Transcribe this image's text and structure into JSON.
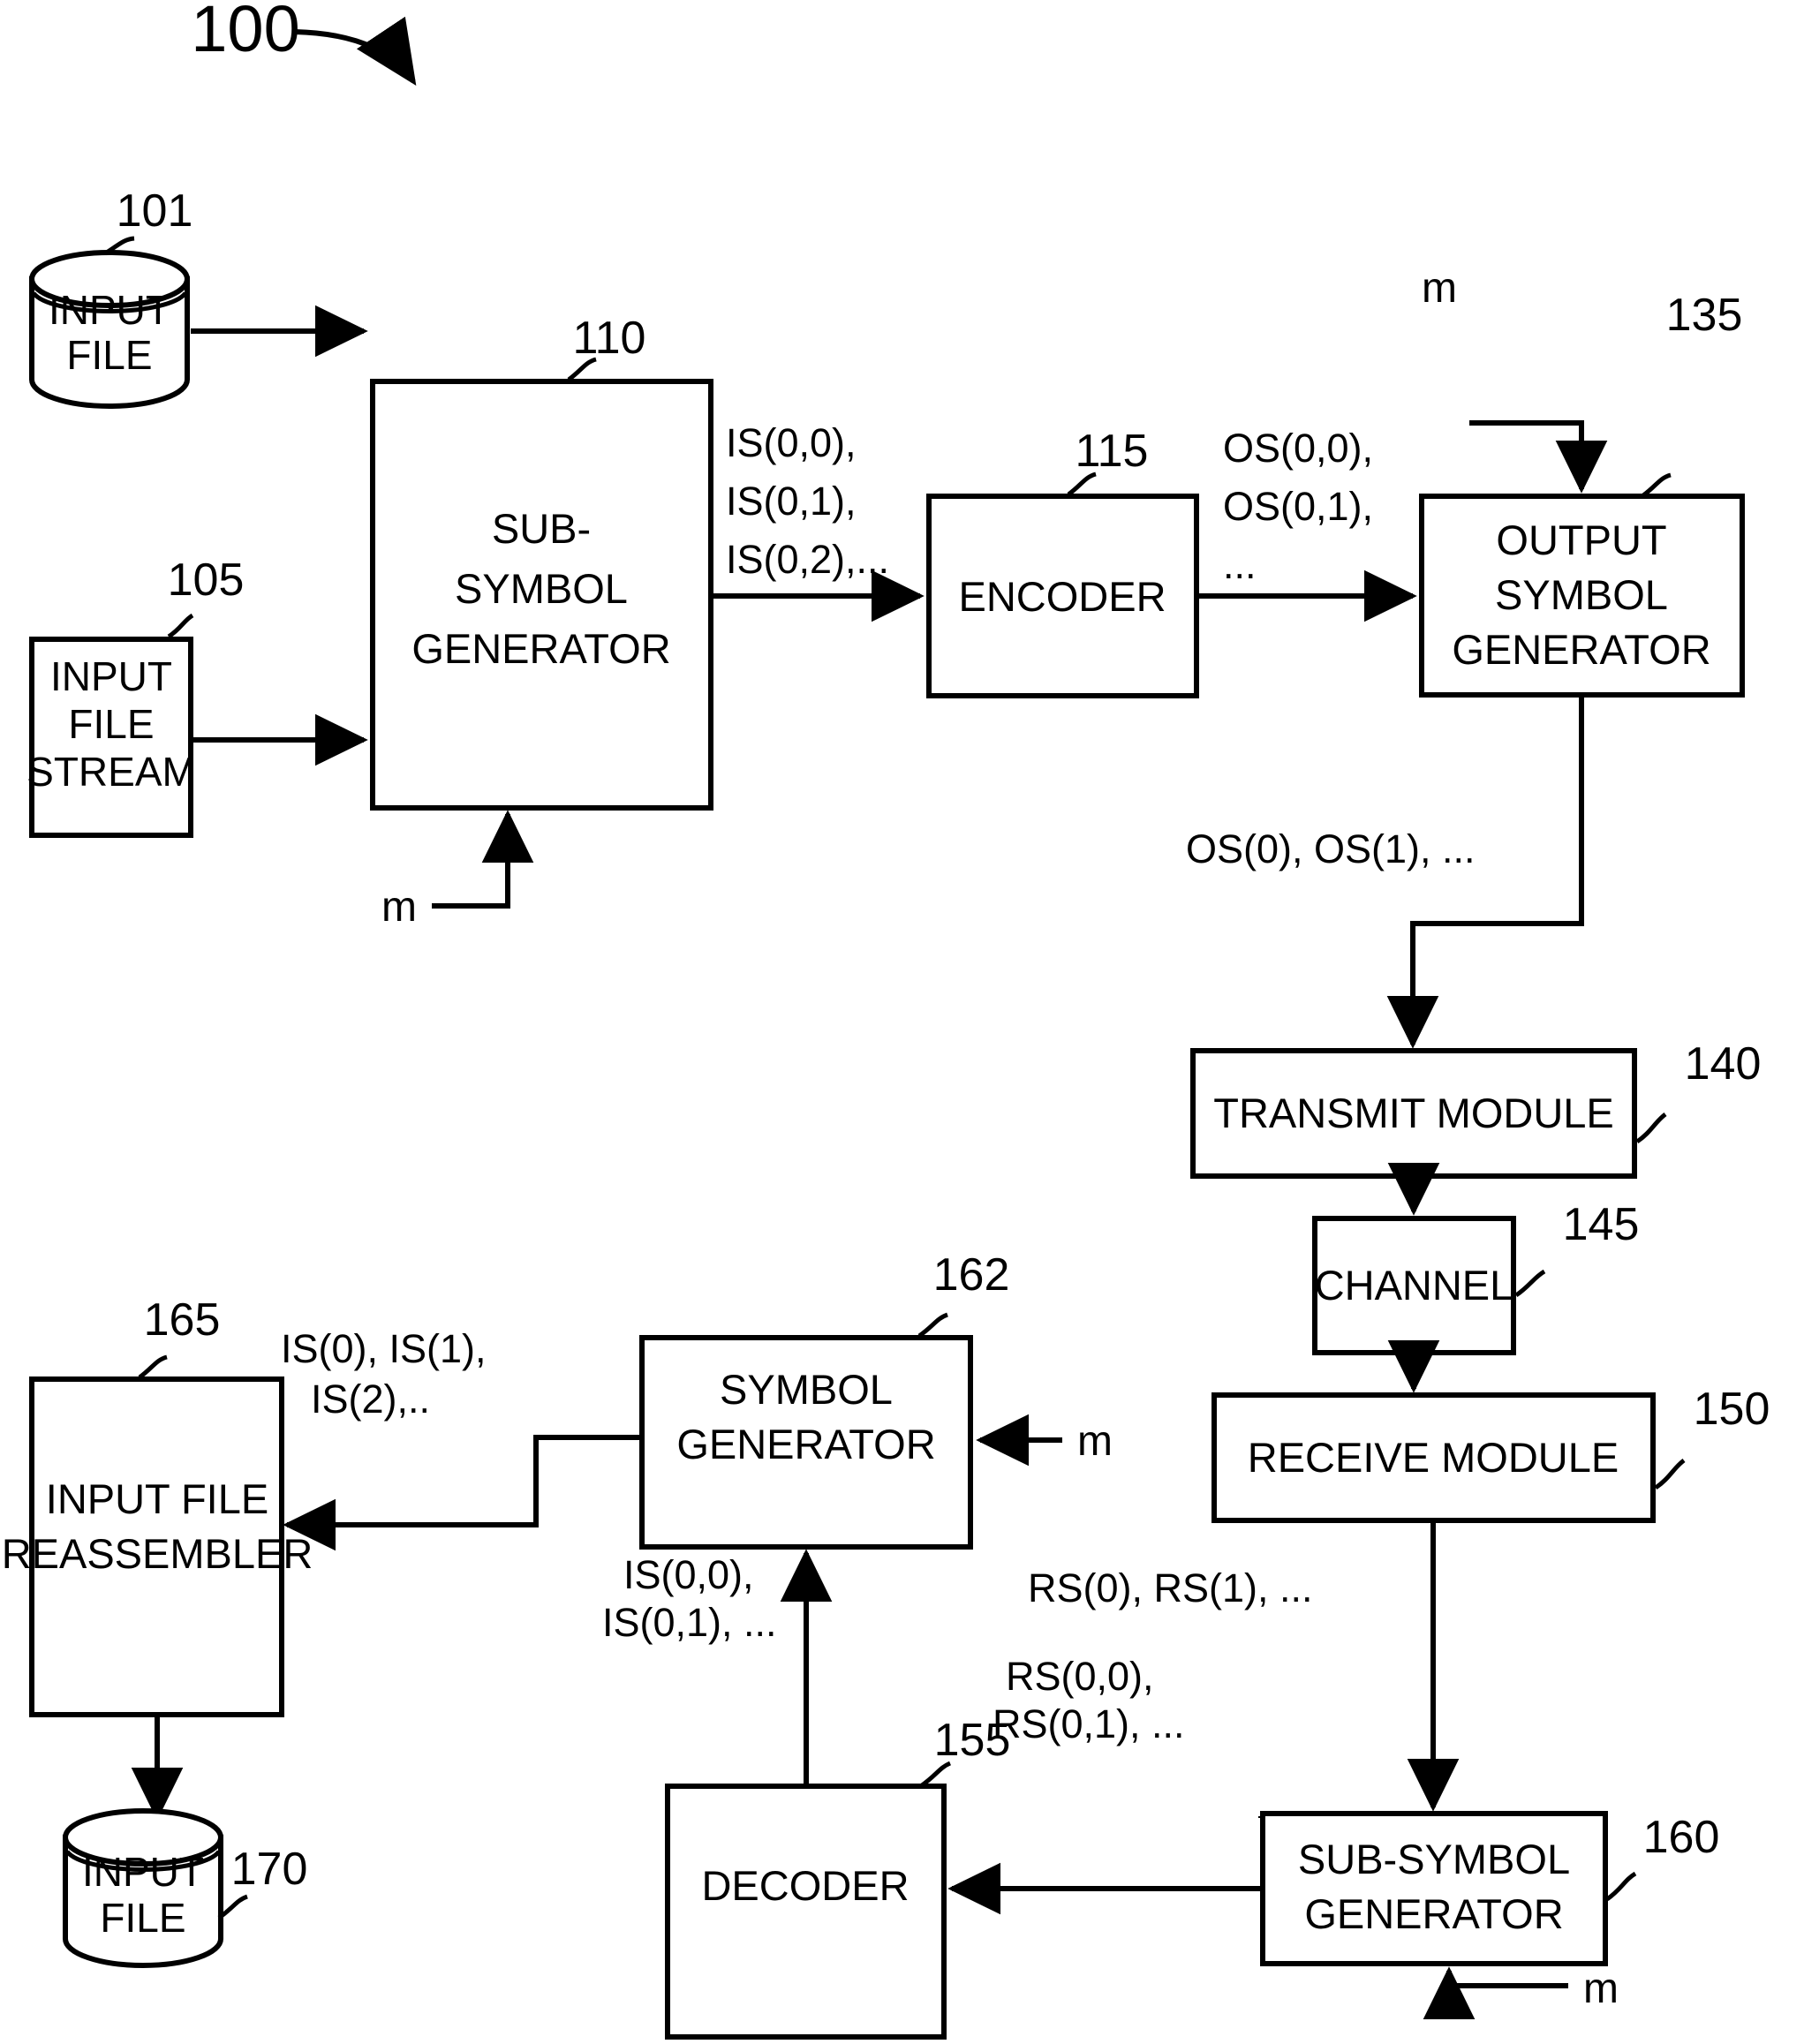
{
  "figure": {
    "number": "100",
    "nodes": {
      "input_file_top": {
        "ref": "101",
        "line1": "INPUT",
        "line2": "FILE"
      },
      "input_file_stream": {
        "ref": "105",
        "line1": "INPUT",
        "line2": "FILE",
        "line3": "STREAM"
      },
      "sub_symbol_generator": {
        "ref": "110",
        "line1": "SUB-",
        "line2": "SYMBOL",
        "line3": "GENERATOR"
      },
      "encoder": {
        "ref": "115",
        "line1": "ENCODER"
      },
      "output_symbol_generator": {
        "ref": "135",
        "line1": "OUTPUT",
        "line2": "SYMBOL",
        "line3": "GENERATOR"
      },
      "transmit_module": {
        "ref": "140",
        "line1": "TRANSMIT MODULE"
      },
      "channel": {
        "ref": "145",
        "line1": "CHANNEL"
      },
      "receive_module": {
        "ref": "150",
        "line1": "RECEIVE MODULE"
      },
      "sub_symbol_generator_rx": {
        "ref": "160",
        "line1": "SUB-SYMBOL",
        "line2": "GENERATOR"
      },
      "decoder": {
        "ref": "155",
        "line1": "DECODER"
      },
      "symbol_generator": {
        "ref": "162",
        "line1": "SYMBOL",
        "line2": "GENERATOR"
      },
      "input_file_reassembler": {
        "ref": "165",
        "line1": "INPUT FILE",
        "line2": "REASSEMBLER"
      },
      "input_file_bottom": {
        "ref": "170",
        "line1": "INPUT",
        "line2": "FILE"
      }
    },
    "signals": {
      "is_sub_tx_l1": "IS(0,0),",
      "is_sub_tx_l2": "IS(0,1),",
      "is_sub_tx_l3": "IS(0,2),...",
      "os_sub_l1": "OS(0,0),",
      "os_sub_l2": "OS(0,1),",
      "os_sub_l3": "...",
      "os_stream": "OS(0), OS(1), ...",
      "rs_stream": "RS(0), RS(1), ...",
      "rs_sub_l1": "RS(0,0),",
      "rs_sub_l2": "RS(0,1), ...",
      "is_sub_rx_l1": "IS(0,0),",
      "is_sub_rx_l2": "IS(0,1), ...",
      "is_stream_l1": "IS(0), IS(1),",
      "is_stream_l2": "IS(2),..",
      "m_sub_tx": "m",
      "m_osg": "m",
      "m_symgen": "m",
      "m_ssg_rx": "m"
    }
  }
}
